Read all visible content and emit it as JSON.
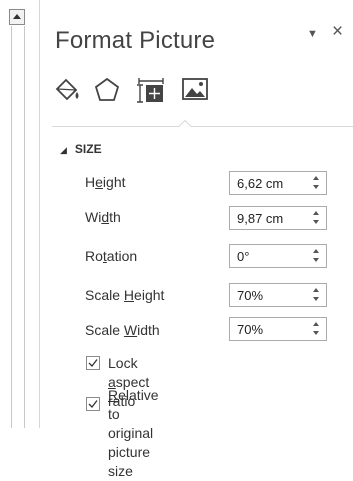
{
  "pane": {
    "title": "Format Picture",
    "menu_glyph": "▼",
    "close_glyph": "×"
  },
  "tabs": [
    {
      "icon": "fill-line-icon"
    },
    {
      "icon": "effects-pentagon-icon"
    },
    {
      "icon": "size-properties-icon",
      "selected": true
    },
    {
      "icon": "picture-icon"
    }
  ],
  "section": {
    "title": "SIZE",
    "rows": [
      {
        "pre": "H",
        "u": "e",
        "post": "ight",
        "value": "6,62 cm"
      },
      {
        "pre": "Wi",
        "u": "d",
        "post": "th",
        "value": "9,87 cm"
      },
      {
        "pre": "Ro",
        "u": "t",
        "post": "ation",
        "value": "0°"
      },
      {
        "pre": "Scale ",
        "u": "H",
        "post": "eight",
        "value": "70%"
      },
      {
        "pre": "Scale ",
        "u": "W",
        "post": "idth",
        "value": "70%"
      }
    ],
    "lock_aspect": {
      "pre": "Lock ",
      "u": "a",
      "post": "spect ratio",
      "checked": true
    },
    "relative": {
      "pre": "",
      "u": "R",
      "post": "elative to original picture",
      "line2": "size",
      "checked": true
    }
  },
  "colors": {
    "icon": "#444444",
    "border": "#ababab"
  }
}
